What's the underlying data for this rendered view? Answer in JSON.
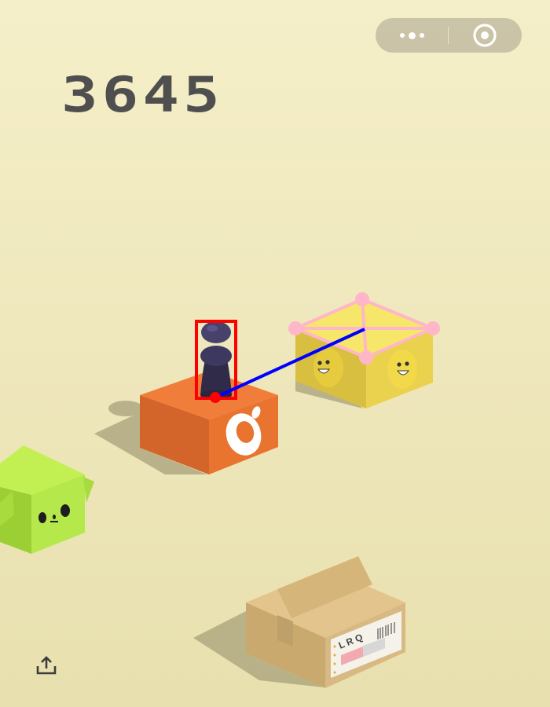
{
  "score": "3645",
  "menu": {
    "more_icon": "more-dots-icon",
    "close_icon": "target-circle-icon"
  },
  "share_icon": "share-upload-icon",
  "boxes": {
    "current": {
      "color": "#e8742f",
      "face_icon": "eyeball-icon"
    },
    "target": {
      "color": "#f0dc58",
      "face_icon": "smiley-face-icon"
    },
    "left": {
      "color": "#b5e84a",
      "face_icon": "cat-face-icon"
    },
    "package": {
      "color": "#d8b983",
      "label_text": "L R Q"
    }
  },
  "overlay": {
    "box_color": "#ff0000",
    "line_color": "#0000ff",
    "grid_color": "#ffb6c8"
  }
}
